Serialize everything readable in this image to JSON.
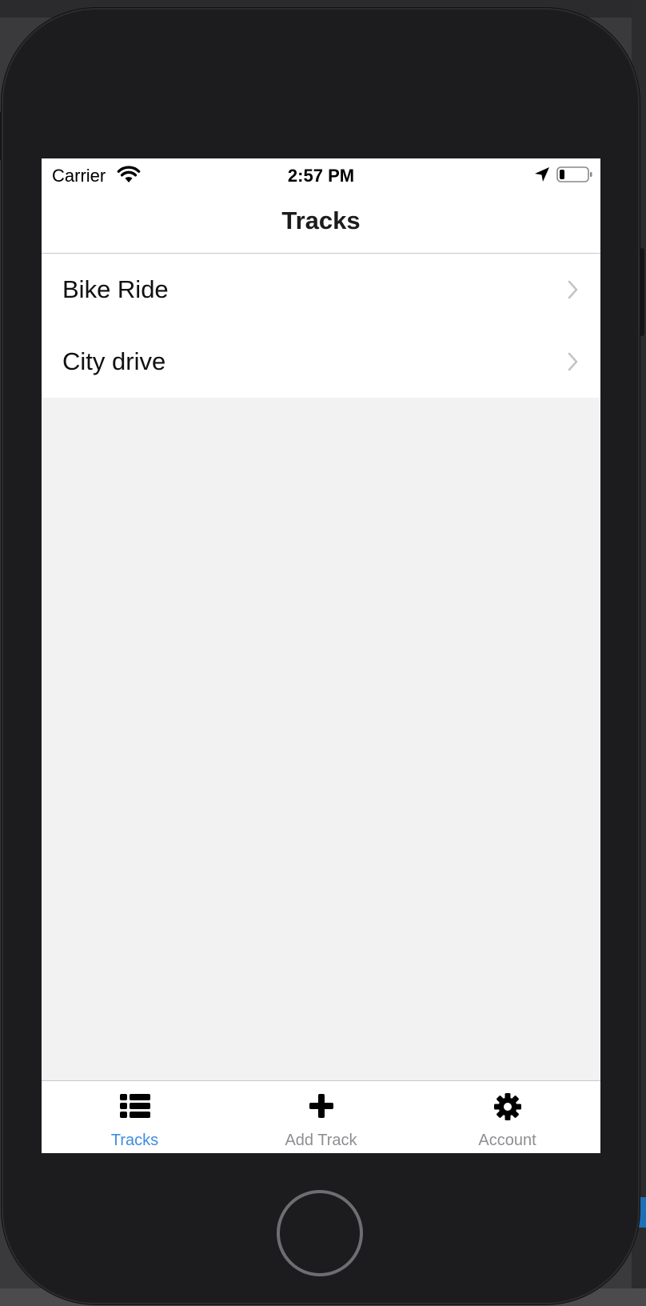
{
  "status_bar": {
    "carrier": "Carrier",
    "time": "2:57 PM",
    "wifi_icon": "wifi-icon",
    "location_icon": "location-arrow-icon",
    "battery_icon": "battery-icon"
  },
  "nav": {
    "title": "Tracks"
  },
  "tracks": [
    {
      "label": "Bike Ride",
      "icon": "chevron-right-icon"
    },
    {
      "label": "City drive",
      "icon": "chevron-right-icon"
    }
  ],
  "tab_bar": {
    "tabs": [
      {
        "label": "Tracks",
        "icon": "list-icon",
        "active": true
      },
      {
        "label": "Add Track",
        "icon": "plus-icon",
        "active": false
      },
      {
        "label": "Account",
        "icon": "gear-icon",
        "active": false
      }
    ]
  },
  "colors": {
    "active_tab": "#3f8de0",
    "inactive_tab": "#8e8e93",
    "list_background": "#f2f2f2",
    "chevron": "#c4c4c7",
    "bezel": "#1c1c1e"
  }
}
